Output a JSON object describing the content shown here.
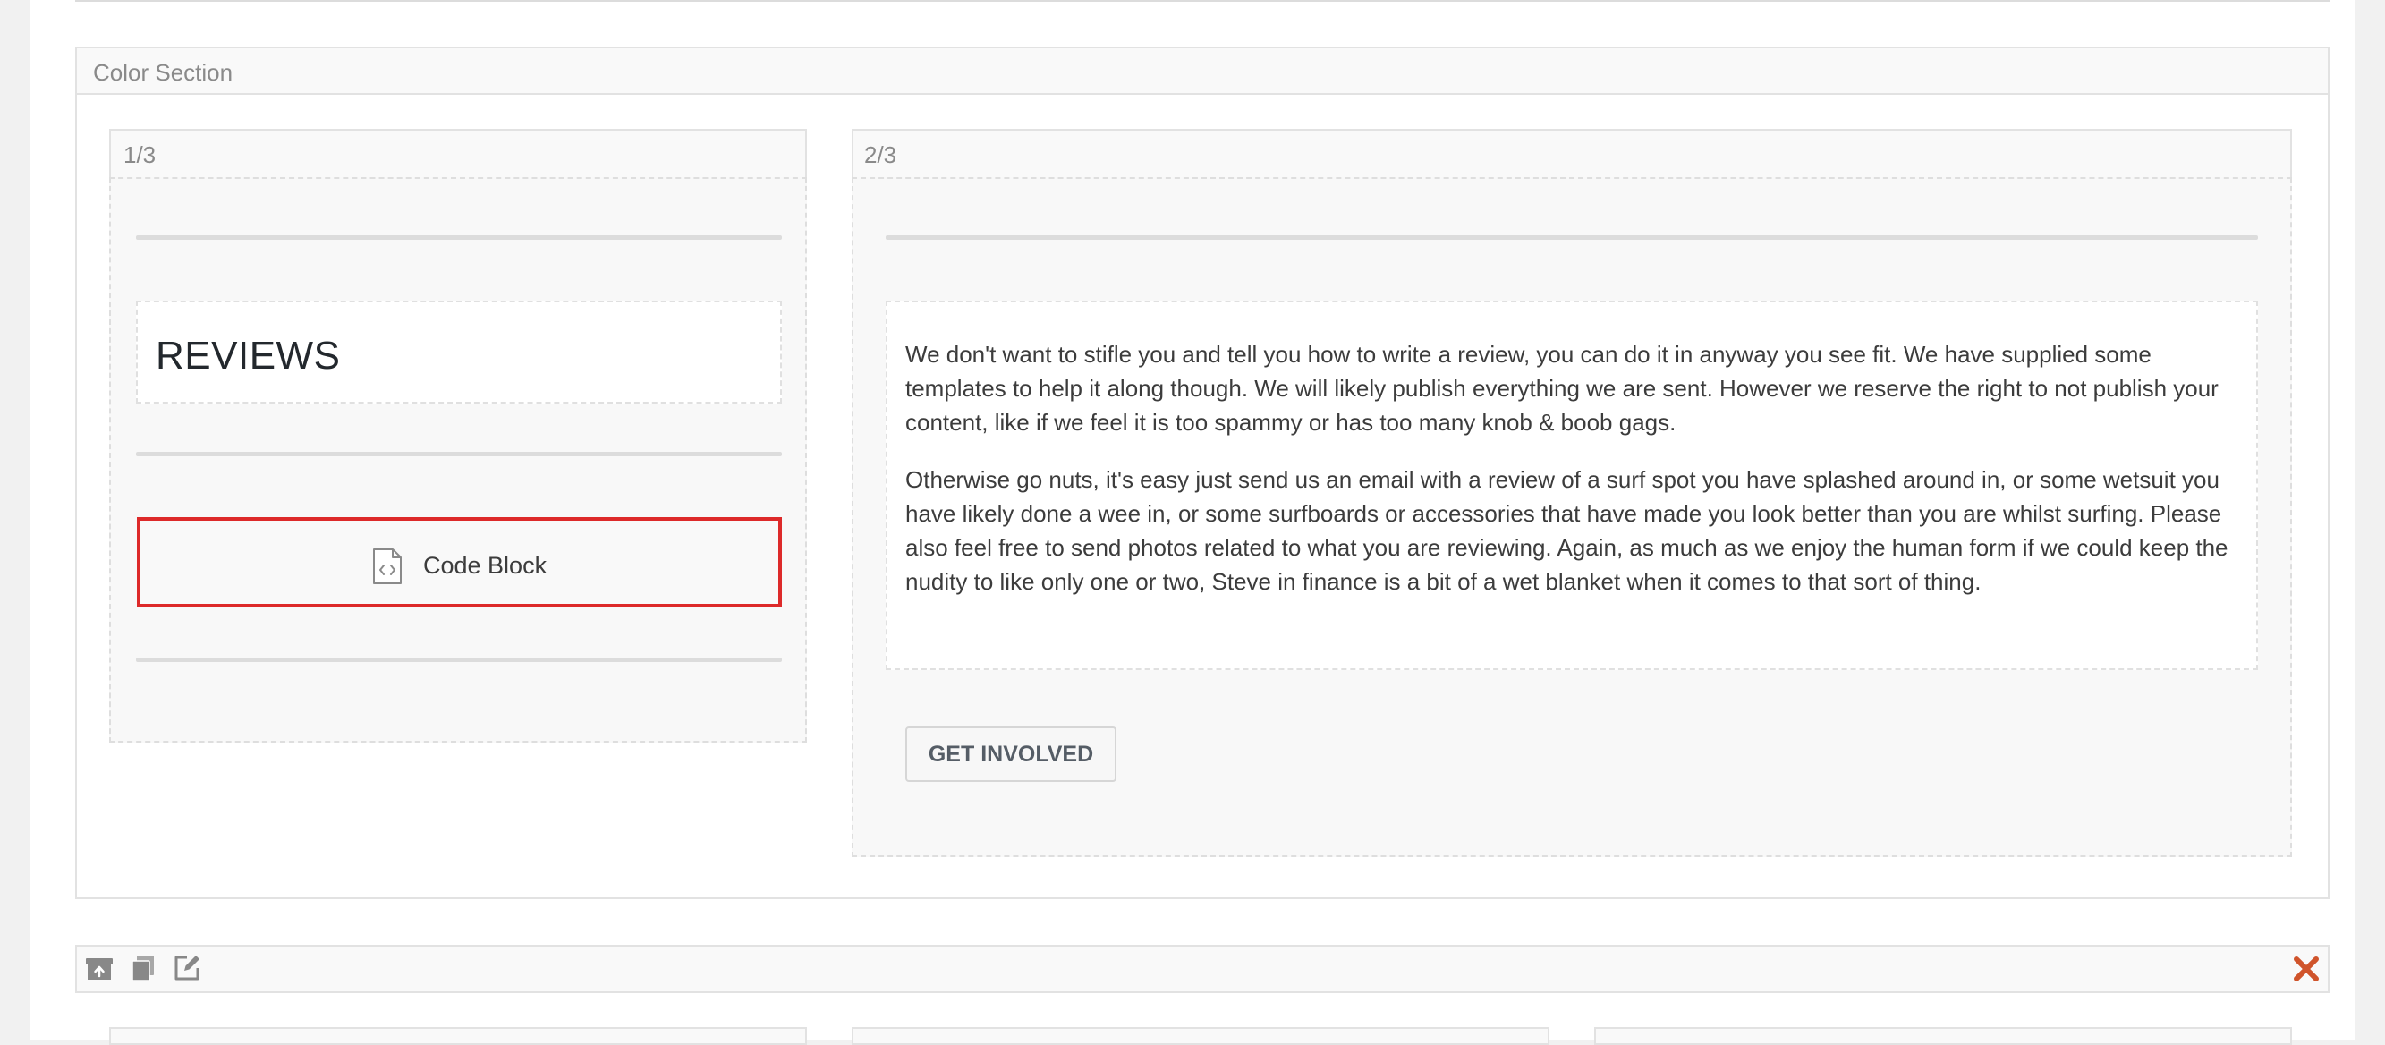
{
  "color_section": {
    "title": "Color Section"
  },
  "columns": {
    "col1_label": "1/3",
    "col2_label": "2/3"
  },
  "reviews": {
    "heading": "REVIEWS"
  },
  "code_block": {
    "label": "Code Block",
    "icon": "code-file-icon"
  },
  "content": {
    "paragraph_1": "We don't want to stifle you and tell you how to write a review, you can do it in anyway you see fit. We have supplied some templates to help it along though. We will likely publish everything we are sent. However we reserve the right to not publish your content, like if we feel it is too spammy or has too many knob & boob gags.",
    "paragraph_2": "Otherwise go nuts, it's easy just send us an email with a review of a surf spot you have splashed around in, or some wetsuit you have likely done a wee in, or some surfboards or accessories that have made you look better than you are whilst surfing. Please also feel free to send photos related to what you are reviewing. Again, as much as we enjoy the human form if we could keep the nudity to like only one or two, Steve in finance is a bit of a wet blanket when it comes to that sort of thing."
  },
  "button": {
    "get_involved": "GET INVOLVED"
  },
  "toolbar": {
    "icons": [
      "archive-icon",
      "copy-icon",
      "edit-icon",
      "close-icon"
    ]
  },
  "colors": {
    "highlight_border": "#dd2a2a",
    "close_icon": "#d0542b",
    "toolbar_icon": "#888888"
  }
}
